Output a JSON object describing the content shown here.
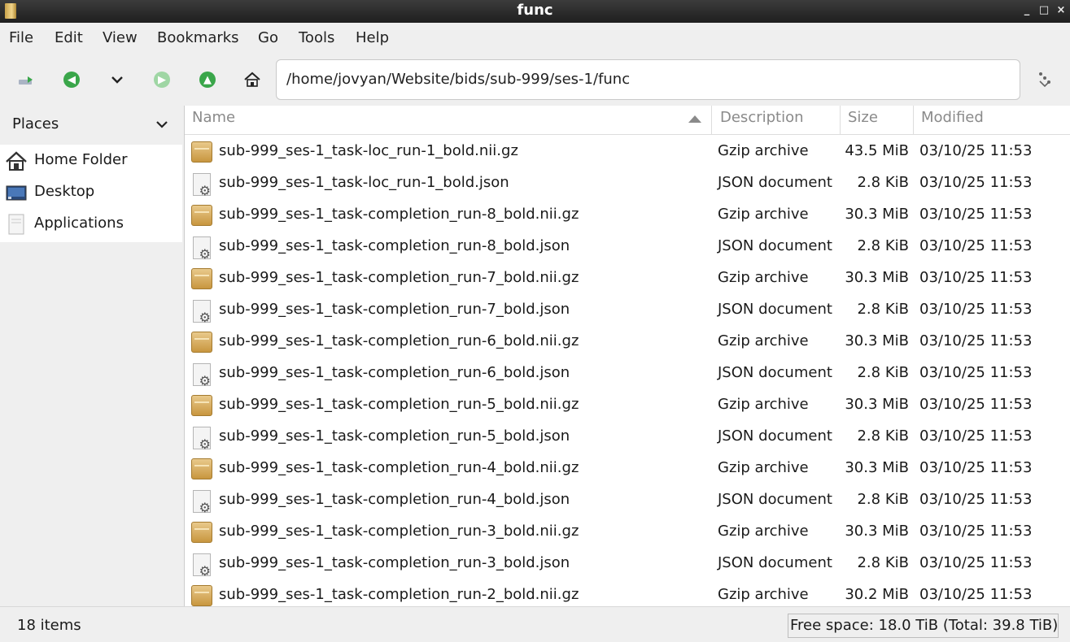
{
  "window": {
    "title": "func",
    "min": "_",
    "max": "□",
    "close": "×"
  },
  "menubar": {
    "items": [
      "File",
      "Edit",
      "View",
      "Bookmarks",
      "Go",
      "Tools",
      "Help"
    ]
  },
  "toolbar": {
    "path": "/home/jovyan/Website/bids/sub-999/ses-1/func"
  },
  "sidebar": {
    "header": "Places",
    "items": [
      {
        "label": "Home Folder",
        "icon": "home-icon"
      },
      {
        "label": "Desktop",
        "icon": "desktop-icon"
      },
      {
        "label": "Applications",
        "icon": "applications-icon"
      }
    ]
  },
  "columns": {
    "name": "Name",
    "description": "Description",
    "size": "Size",
    "modified": "Modified"
  },
  "files": [
    {
      "name": "sub-999_ses-1_task-loc_run-1_bold.nii.gz",
      "description": "Gzip archive",
      "size": "43.5 MiB",
      "modified": "03/10/25 11:53",
      "icon": "gz"
    },
    {
      "name": "sub-999_ses-1_task-loc_run-1_bold.json",
      "description": "JSON document",
      "size": "2.8 KiB",
      "modified": "03/10/25 11:53",
      "icon": "json"
    },
    {
      "name": "sub-999_ses-1_task-completion_run-8_bold.nii.gz",
      "description": "Gzip archive",
      "size": "30.3 MiB",
      "modified": "03/10/25 11:53",
      "icon": "gz"
    },
    {
      "name": "sub-999_ses-1_task-completion_run-8_bold.json",
      "description": "JSON document",
      "size": "2.8 KiB",
      "modified": "03/10/25 11:53",
      "icon": "json"
    },
    {
      "name": "sub-999_ses-1_task-completion_run-7_bold.nii.gz",
      "description": "Gzip archive",
      "size": "30.3 MiB",
      "modified": "03/10/25 11:53",
      "icon": "gz"
    },
    {
      "name": "sub-999_ses-1_task-completion_run-7_bold.json",
      "description": "JSON document",
      "size": "2.8 KiB",
      "modified": "03/10/25 11:53",
      "icon": "json"
    },
    {
      "name": "sub-999_ses-1_task-completion_run-6_bold.nii.gz",
      "description": "Gzip archive",
      "size": "30.3 MiB",
      "modified": "03/10/25 11:53",
      "icon": "gz"
    },
    {
      "name": "sub-999_ses-1_task-completion_run-6_bold.json",
      "description": "JSON document",
      "size": "2.8 KiB",
      "modified": "03/10/25 11:53",
      "icon": "json"
    },
    {
      "name": "sub-999_ses-1_task-completion_run-5_bold.nii.gz",
      "description": "Gzip archive",
      "size": "30.3 MiB",
      "modified": "03/10/25 11:53",
      "icon": "gz"
    },
    {
      "name": "sub-999_ses-1_task-completion_run-5_bold.json",
      "description": "JSON document",
      "size": "2.8 KiB",
      "modified": "03/10/25 11:53",
      "icon": "json"
    },
    {
      "name": "sub-999_ses-1_task-completion_run-4_bold.nii.gz",
      "description": "Gzip archive",
      "size": "30.3 MiB",
      "modified": "03/10/25 11:53",
      "icon": "gz"
    },
    {
      "name": "sub-999_ses-1_task-completion_run-4_bold.json",
      "description": "JSON document",
      "size": "2.8 KiB",
      "modified": "03/10/25 11:53",
      "icon": "json"
    },
    {
      "name": "sub-999_ses-1_task-completion_run-3_bold.nii.gz",
      "description": "Gzip archive",
      "size": "30.3 MiB",
      "modified": "03/10/25 11:53",
      "icon": "gz"
    },
    {
      "name": "sub-999_ses-1_task-completion_run-3_bold.json",
      "description": "JSON document",
      "size": "2.8 KiB",
      "modified": "03/10/25 11:53",
      "icon": "json"
    },
    {
      "name": "sub-999_ses-1_task-completion_run-2_bold.nii.gz",
      "description": "Gzip archive",
      "size": "30.2 MiB",
      "modified": "03/10/25 11:53",
      "icon": "gz"
    }
  ],
  "status": {
    "count": "18 items",
    "free_space": "Free space: 18.0 TiB (Total: 39.8 TiB)"
  },
  "colors": {
    "accent_green": "#3aa64a",
    "titlebar": "#2a2a2a"
  }
}
